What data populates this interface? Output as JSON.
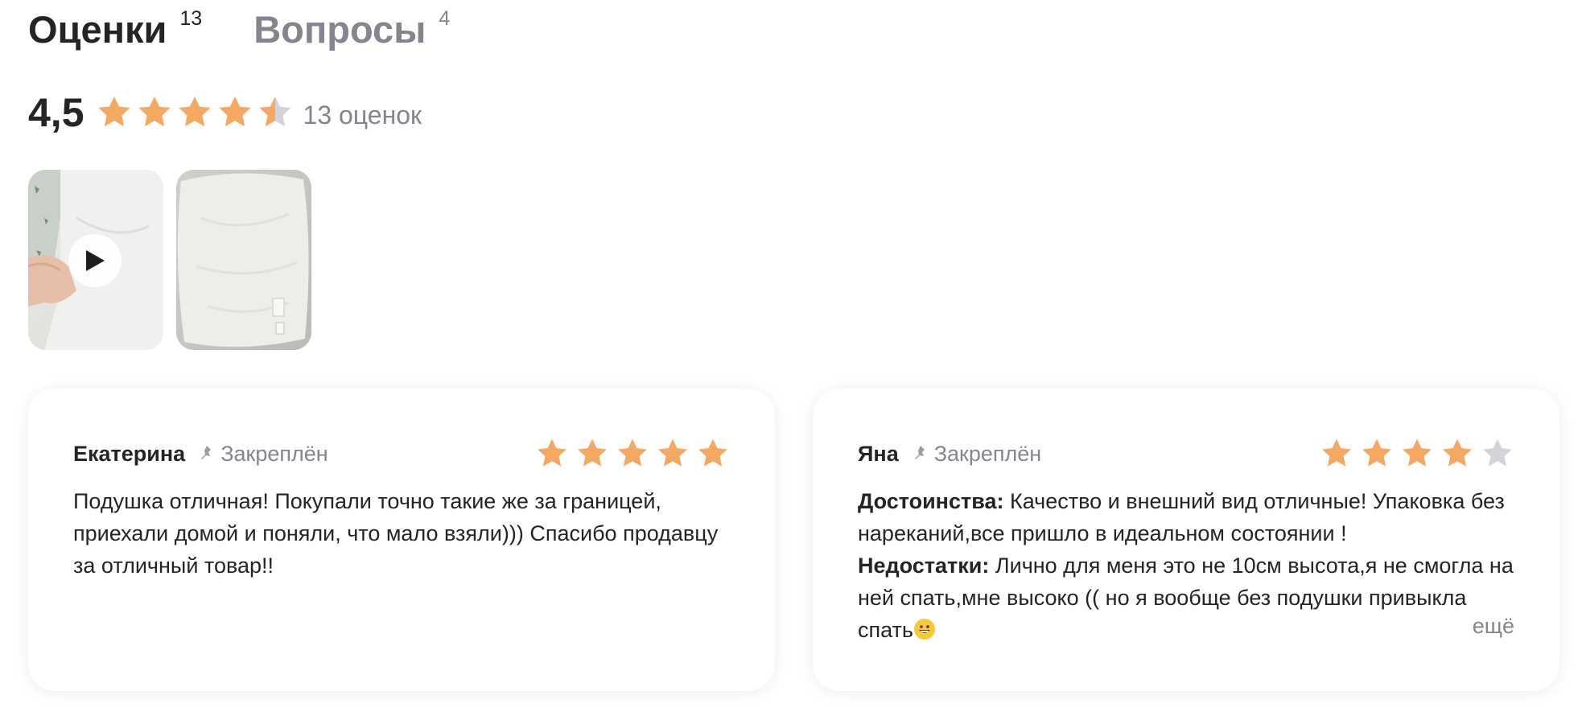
{
  "tabs": [
    {
      "label": "Оценки",
      "count": "13",
      "active": true
    },
    {
      "label": "Вопросы",
      "count": "4",
      "active": false
    }
  ],
  "summary": {
    "average": "4,5",
    "rating_value": 4.5,
    "rating_max": 5,
    "count_text": "13 оценок"
  },
  "media": [
    {
      "kind": "video",
      "icon": "play-icon"
    },
    {
      "kind": "photo"
    }
  ],
  "reviews": [
    {
      "author": "Екатерина",
      "pinned_label": "Закреплён",
      "rating": 5,
      "text": "Подушка отличная! Покупали точно такие же за границей, приехали домой и поняли, что мало взяли))) Спасибо продавцу за отличный товар!!"
    },
    {
      "author": "Яна",
      "pinned_label": "Закреплён",
      "rating": 4,
      "pros_label": "Достоинства:",
      "pros_text": "Качество и внешний вид отличные! Упаковка без нареканий,все пришло в идеальном состоянии !",
      "cons_label": "Недостатки:",
      "cons_text": "Лично для меня это не 10см высота,я не смогла на ней спать,мне высоко (( но я вообще без подушки привыкла спать",
      "more_label": "ещё"
    }
  ],
  "colors": {
    "star_filled": "#f5a860",
    "star_empty": "#d5d3da",
    "text_primary": "#242424",
    "text_secondary": "#87838f"
  }
}
